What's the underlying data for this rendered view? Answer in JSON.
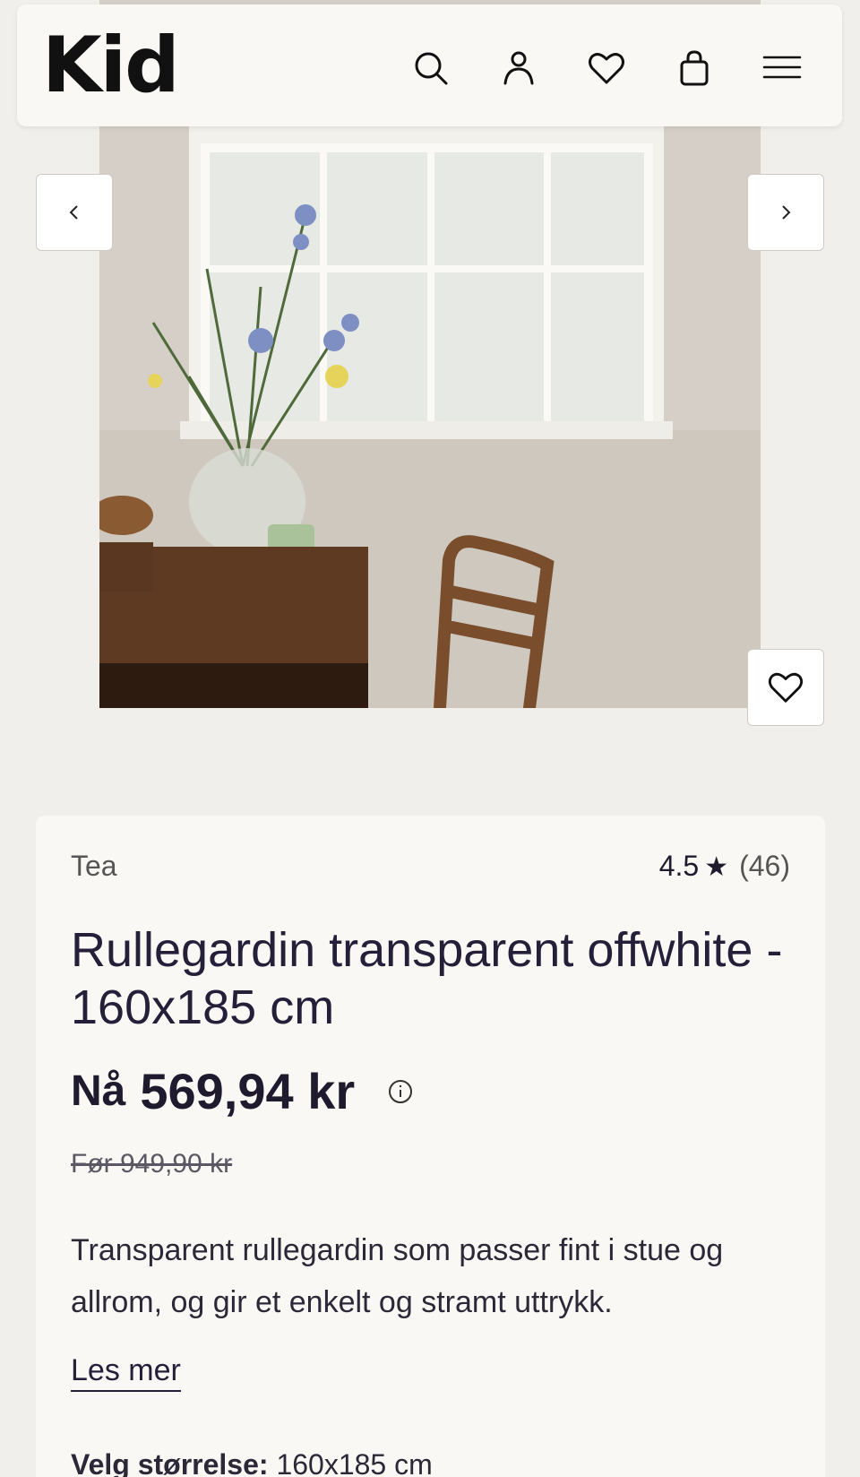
{
  "header": {
    "logo": "Kid",
    "icons": [
      "search-icon",
      "account-icon",
      "wishlist-icon",
      "cart-icon",
      "menu-icon"
    ]
  },
  "carousel": {
    "prev_icon": "chevron-left-icon",
    "next_icon": "chevron-right-icon",
    "favorite_icon": "heart-icon"
  },
  "product": {
    "brand": "Tea",
    "rating": "4.5",
    "rating_star": "★",
    "review_count": "(46)",
    "title": "Rullegardin transparent offwhite - 160x185 cm",
    "price_prefix": "Nå",
    "price": "569,94 kr",
    "before_price": "Før 949,90 kr",
    "description": "Transparent rullegardin som passer fint i stue og allrom, og gir et enkelt og stramt uttrykk.",
    "read_more": "Les mer",
    "size_label": "Velg størrelse:",
    "size_value": "160x185 cm"
  },
  "colors": {
    "page_bg": "#f1efeb",
    "card_bg": "#faf8f4",
    "text": "#1f1b2e"
  }
}
